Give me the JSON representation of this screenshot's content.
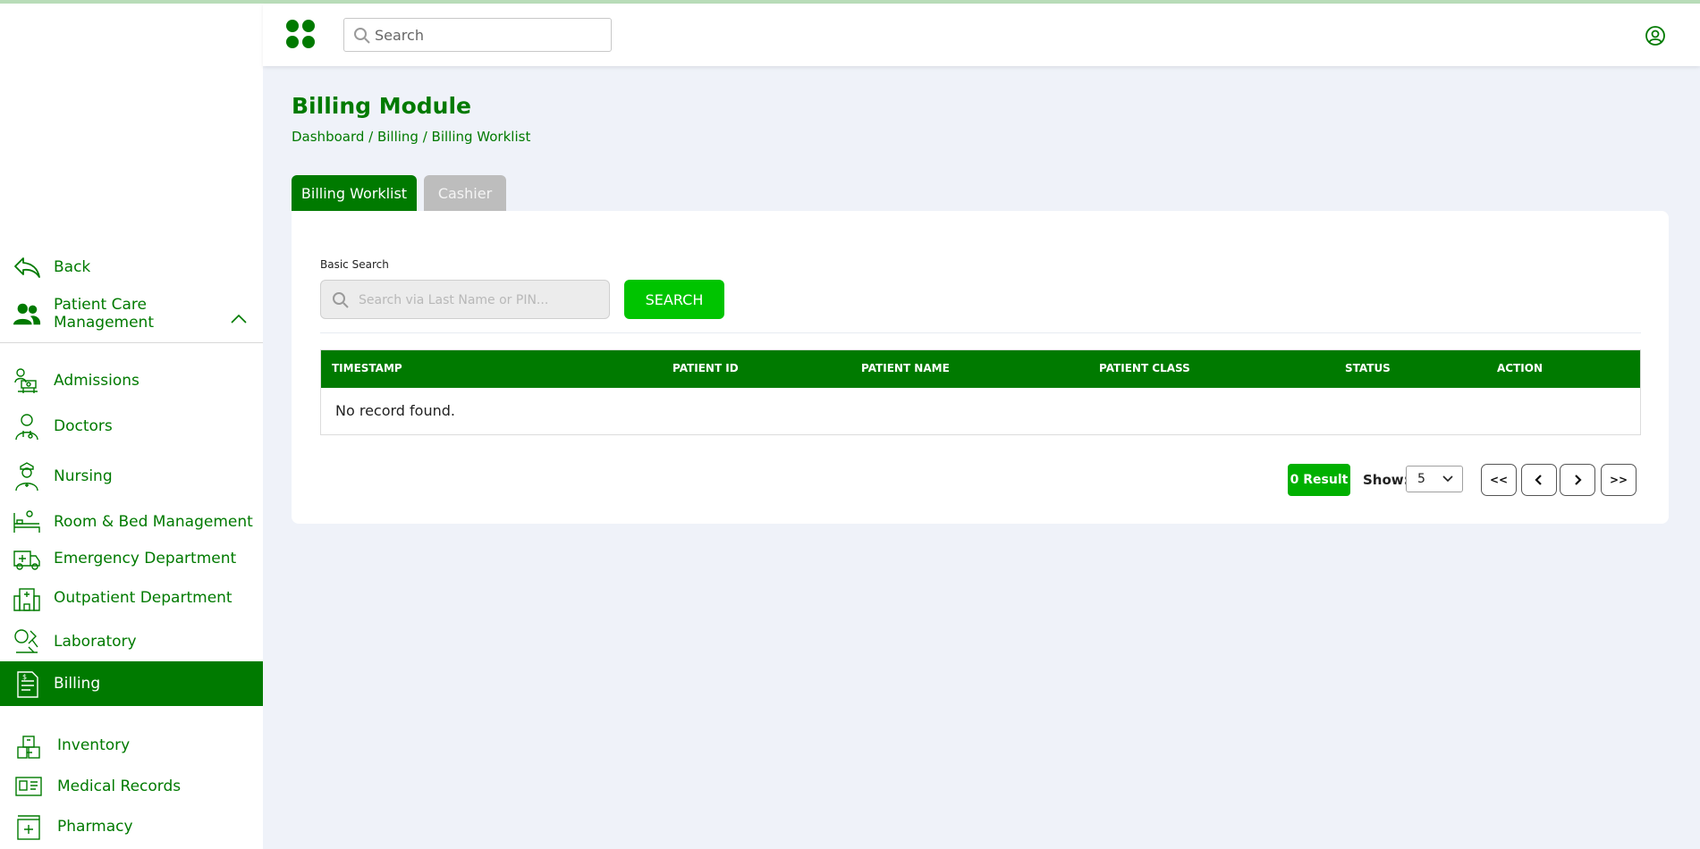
{
  "header": {
    "search_placeholder": "Search"
  },
  "sidebar": {
    "back_label": "Back",
    "section_label": "Patient Care Management",
    "items": [
      {
        "label": "Admissions"
      },
      {
        "label": "Doctors"
      },
      {
        "label": "Nursing"
      },
      {
        "label": "Room & Bed Management"
      },
      {
        "label": "Emergency Department"
      },
      {
        "label": "Outpatient Department"
      },
      {
        "label": "Laboratory"
      },
      {
        "label": "Billing",
        "active": true
      },
      {
        "label": "Inventory"
      },
      {
        "label": "Medical Records"
      },
      {
        "label": "Pharmacy"
      }
    ]
  },
  "main": {
    "title": "Billing Module",
    "breadcrumb": "Dashboard / Billing / Billing Worklist",
    "tabs": [
      {
        "label": "Billing Worklist",
        "active": true
      },
      {
        "label": "Cashier",
        "active": false
      }
    ],
    "basic_search": {
      "label": "Basic Search",
      "placeholder": "Search via Last Name or PIN...",
      "button_label": "SEARCH"
    },
    "table": {
      "columns": [
        "TIMESTAMP",
        "PATIENT ID",
        "PATIENT NAME",
        "PATIENT CLASS",
        "STATUS",
        "ACTION"
      ],
      "rows": [],
      "empty_message": "No record found."
    },
    "pagination": {
      "result_label": "0 Result",
      "show_label": "Show:",
      "page_size": "5",
      "first_label": "<<",
      "last_label": ">>"
    }
  },
  "colors": {
    "brand_green": "#007a00",
    "bright_green": "#00c400",
    "background": "#eff2f9",
    "tab_inactive": "#bdbdbd"
  }
}
